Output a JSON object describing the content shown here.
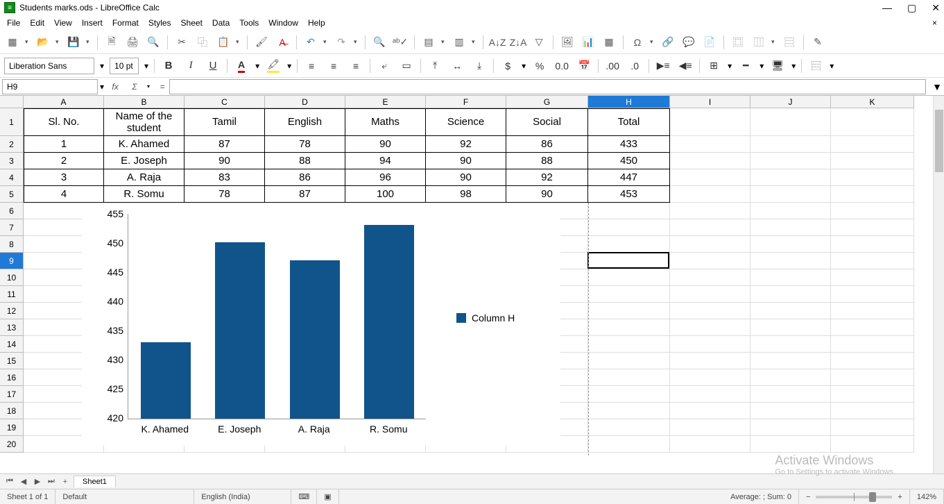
{
  "app": {
    "title": "Students marks.ods - LibreOffice Calc",
    "doc_icon_letter": "≡"
  },
  "menus": [
    "File",
    "Edit",
    "View",
    "Insert",
    "Format",
    "Styles",
    "Sheet",
    "Data",
    "Tools",
    "Window",
    "Help"
  ],
  "format_bar": {
    "font_name": "Liberation Sans",
    "font_size": "10 pt"
  },
  "cell_ref": "H9",
  "columns": [
    "A",
    "B",
    "C",
    "D",
    "E",
    "F",
    "G",
    "H",
    "I",
    "J",
    "K"
  ],
  "col_widths": {
    "A": 116,
    "B": 116,
    "C": 116,
    "D": 116,
    "E": 116,
    "F": 116,
    "G": 118,
    "H": 118,
    "I": 116,
    "J": 116,
    "K": 120
  },
  "selected_col": "H",
  "row_count": 20,
  "header_row_height": 40,
  "data_row_height": 24,
  "selected_row": 9,
  "selected_cell": {
    "col": "H",
    "row": 9
  },
  "table": {
    "headers": [
      "Sl. No.",
      "Name of the\nstudent",
      "Tamil",
      "English",
      "Maths",
      "Science",
      "Social",
      "Total"
    ],
    "rows": [
      [
        "1",
        "K. Ahamed",
        "87",
        "78",
        "90",
        "92",
        "86",
        "433"
      ],
      [
        "2",
        "E. Joseph",
        "90",
        "88",
        "94",
        "90",
        "88",
        "450"
      ],
      [
        "3",
        "A. Raja",
        "83",
        "86",
        "96",
        "90",
        "92",
        "447"
      ],
      [
        "4",
        "R. Somu",
        "78",
        "87",
        "100",
        "98",
        "90",
        "453"
      ]
    ]
  },
  "chart_data": {
    "type": "bar",
    "categories": [
      "K. Ahamed",
      "E. Joseph",
      "A. Raja",
      "R. Somu"
    ],
    "series": [
      {
        "name": "Column H",
        "values": [
          433,
          450,
          447,
          453
        ]
      }
    ],
    "ylim": [
      420,
      455
    ],
    "yticks": [
      455,
      450,
      445,
      440,
      435,
      430,
      425,
      420
    ],
    "title": "",
    "xlabel": "",
    "ylabel": ""
  },
  "sheet_tabs": {
    "active": "Sheet1"
  },
  "status": {
    "sheet_info": "Sheet 1 of 1",
    "style": "Default",
    "language": "English (India)",
    "summary": "Average: ; Sum: 0",
    "zoom": "142%"
  },
  "watermark": {
    "line1": "Activate Windows",
    "line2": "Go to Settings to activate Windows."
  }
}
